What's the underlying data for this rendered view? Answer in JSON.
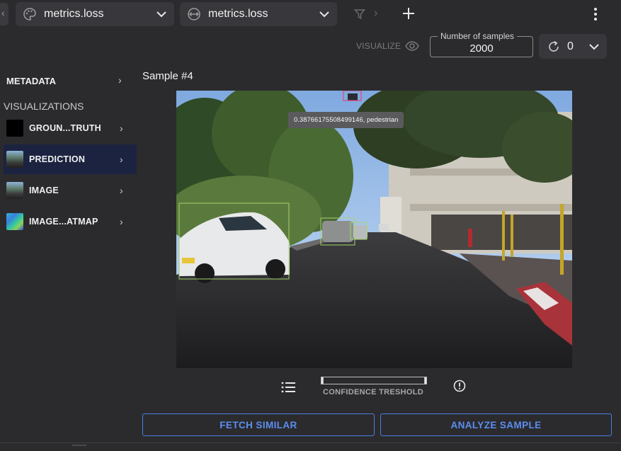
{
  "toolbar": {
    "left_stub_glyph": "‹",
    "dropdown_a": {
      "icon": "palette-icon",
      "label": "metrics.loss"
    },
    "dropdown_b": {
      "icon": "ring-arrows-icon",
      "label": "metrics.loss"
    },
    "filter_icon": "funnel-icon",
    "arrow_glyph": "›",
    "add_icon": "plus-icon",
    "menu_icon": "kebab-icon"
  },
  "controls": {
    "visualize_label": "VISUALIZE",
    "visualize_icon": "eye-icon",
    "samples_legend": "Number of samples",
    "samples_value": "2000",
    "refresh_value": "0"
  },
  "sidebar": {
    "metadata_label": "METADATA",
    "visualizations_heading": "VISUALIZATIONS",
    "items": [
      {
        "label": "GROUN...TRUTH",
        "thumb": "black",
        "active": false
      },
      {
        "label": "PREDICTION",
        "thumb": "street-image",
        "active": true
      },
      {
        "label": "IMAGE",
        "thumb": "street-image",
        "active": false
      },
      {
        "label": "IMAGE...ATMAP",
        "thumb": "heatmap",
        "active": false
      }
    ],
    "chevron": "›"
  },
  "main": {
    "sample_title": "Sample #4",
    "tooltip": "0.38766175508499146, pedestrian",
    "confidence_label": "CONFIDENCE TRESHOLD",
    "confidence_range": [
      0,
      1
    ],
    "buttons": {
      "fetch_similar": "FETCH SIMILAR",
      "analyze_sample": "ANALYZE SAMPLE"
    }
  },
  "colors": {
    "background": "#2b2b2e",
    "panel": "#38383c",
    "active_item": "#1c2340",
    "accent": "#5b8ef0",
    "box_car": "#a7d36a",
    "box_pedestrian": "#e0457a"
  }
}
